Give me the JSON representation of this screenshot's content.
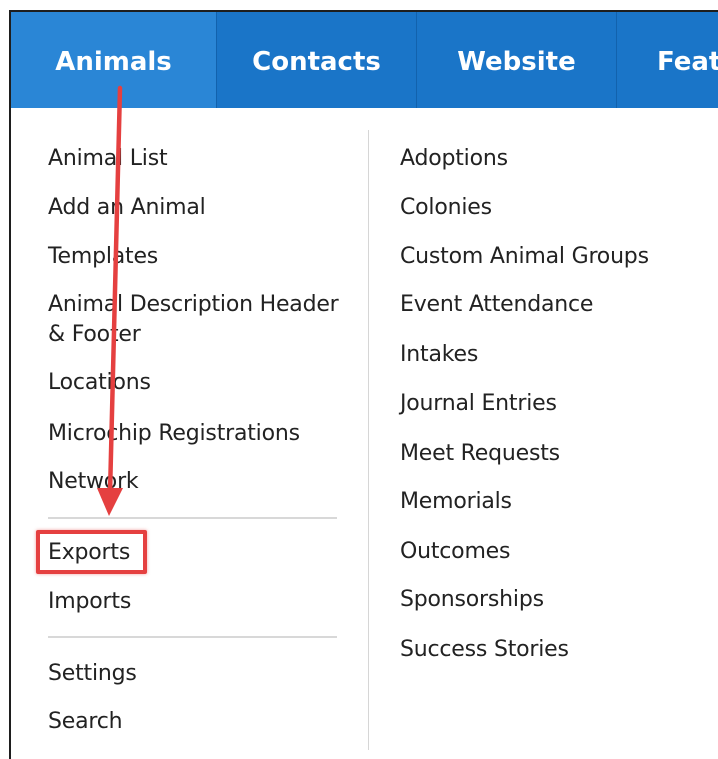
{
  "nav": {
    "tabs": [
      {
        "label": "Animals"
      },
      {
        "label": "Contacts"
      },
      {
        "label": "Website"
      },
      {
        "label": "Feat"
      }
    ]
  },
  "menu": {
    "left_group1": [
      "Animal List",
      "Add an Animal",
      "Templates",
      "Animal Description Header & Footer",
      "Locations",
      "Microchip Registrations",
      "Network"
    ],
    "left_group2": [
      "Exports",
      "Imports"
    ],
    "left_group3": [
      "Settings",
      "Search"
    ],
    "right": [
      "Adoptions",
      "Colonies",
      "Custom Animal Groups",
      "Event Attendance",
      "Intakes",
      "Journal Entries",
      "Meet Requests",
      "Memorials",
      "Outcomes",
      "Sponsorships",
      "Success Stories"
    ]
  },
  "annotation": {
    "color": "#e54040",
    "highlighted_item": "Exports"
  },
  "colors": {
    "nav_bg": "#1a75c8",
    "nav_active": "#2a86d6"
  }
}
